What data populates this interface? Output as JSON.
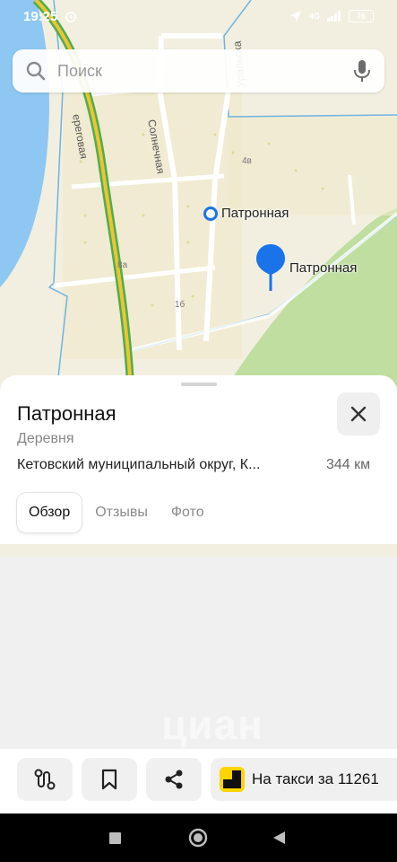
{
  "status_bar": {
    "time": "19:25",
    "network": "4G",
    "battery": "76"
  },
  "search": {
    "placeholder": "Поиск"
  },
  "map": {
    "labels": {
      "marker_circle": "Патронная",
      "marker_pin": "Патронная"
    },
    "streets": {
      "beregovaya": "ереговая",
      "solnechnaya": "Солнечная",
      "uralskaya": "Уральска"
    },
    "houses": {
      "h4v": "4в",
      "h8a": "8а",
      "h1b": "1б"
    }
  },
  "place": {
    "title": "Патронная",
    "type": "Деревня",
    "address": "Кетовский муниципальный округ, К...",
    "distance": "344 км"
  },
  "tabs": [
    {
      "label": "Обзор",
      "active": true
    },
    {
      "label": "Отзывы",
      "active": false
    },
    {
      "label": "Фото",
      "active": false
    }
  ],
  "watermark": "циан",
  "actions": {
    "route_icon": "route-icon",
    "bookmark_icon": "bookmark-icon",
    "share_icon": "share-icon",
    "taxi_label": "На такси за 11261"
  },
  "colors": {
    "water": "#8ec8f2",
    "forest": "#bfdea0",
    "pin": "#1a73e8",
    "road_yellow": "#f1c232",
    "road_green": "#4caf50"
  }
}
